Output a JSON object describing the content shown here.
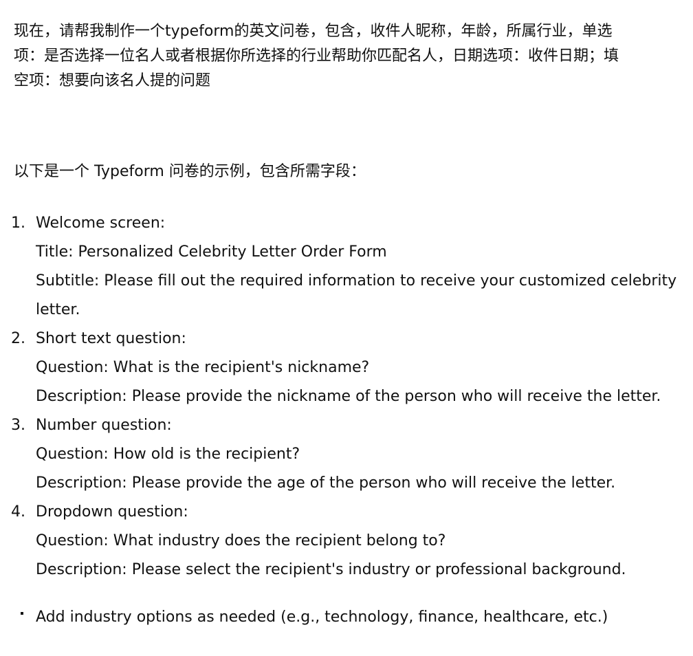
{
  "prompt": {
    "lines": [
      "现在，请帮我制作一个typeform的英文问卷，包含，收件人昵称，年龄，所属行业，单选",
      "项：是否选择一位名人或者根据你所选择的行业帮助你匹配名人，日期选项：收件日期；填",
      "空项：想要向该名人提的问题"
    ]
  },
  "response": {
    "intro": "以下是一个 Typeform 问卷的示例，包含所需字段：",
    "steps": [
      {
        "number": "1.",
        "lines": [
          "Welcome screen:",
          "Title: Personalized Celebrity Letter Order Form",
          "Subtitle: Please fill out the required information to receive your customized celebrity",
          "letter."
        ]
      },
      {
        "number": "2.",
        "lines": [
          "Short text question:",
          "Question: What is the recipient's nickname?",
          "Description: Please provide the nickname of the person who will receive the letter."
        ]
      },
      {
        "number": "3.",
        "lines": [
          "Number question:",
          "Question: How old is the recipient?",
          "Description: Please provide the age of the person who will receive the letter."
        ]
      },
      {
        "number": "4.",
        "lines": [
          "Dropdown question:",
          "Question: What industry does the recipient belong to?",
          "Description: Please select the recipient's industry or professional background."
        ]
      }
    ],
    "bullets": [
      "Add industry options as needed (e.g., technology, finance, healthcare, etc.)"
    ]
  }
}
